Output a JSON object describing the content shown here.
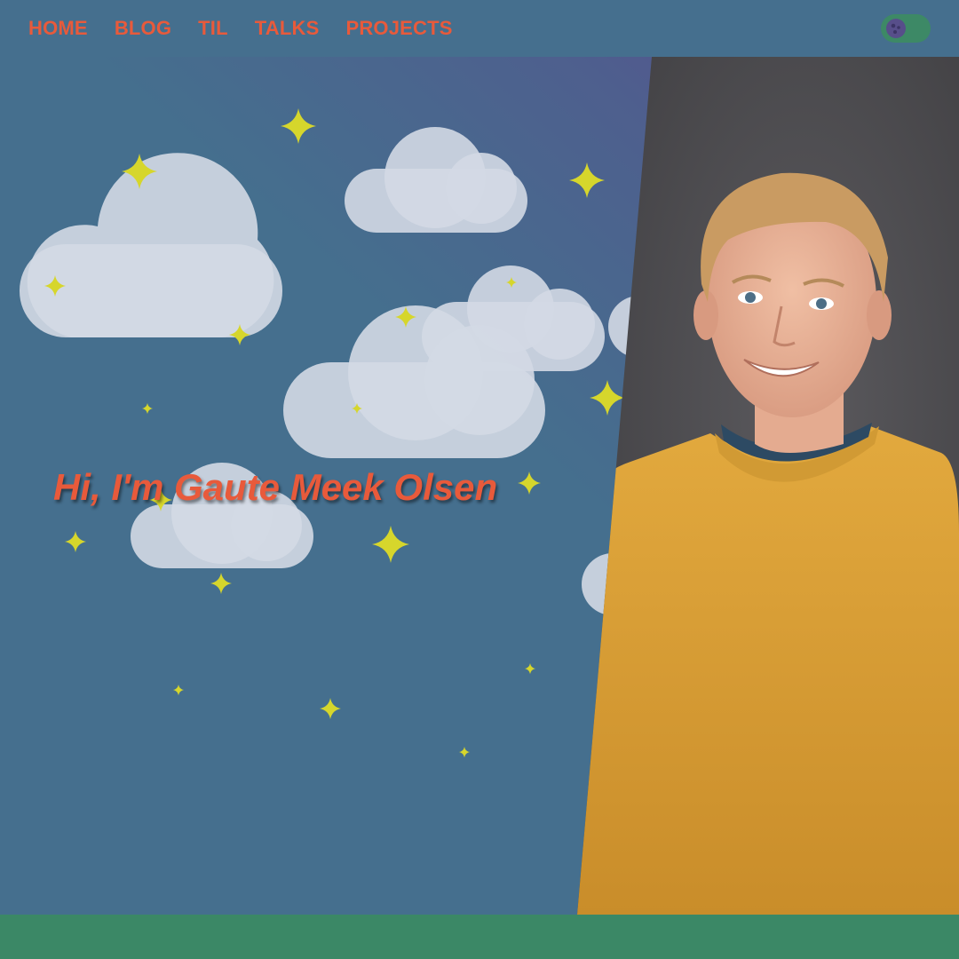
{
  "nav": {
    "items": [
      {
        "label": "HOME"
      },
      {
        "label": "BLOG"
      },
      {
        "label": "TIL"
      },
      {
        "label": "TALKS"
      },
      {
        "label": "PROJECTS"
      }
    ]
  },
  "theme_toggle": {
    "icon": "moon-icon",
    "state": "dark"
  },
  "hero": {
    "heading": "Hi, I'm Gaute Meek Olsen",
    "photo": "portrait-photo"
  },
  "colors": {
    "background": "#456f8e",
    "nav_text": "#e85a3b",
    "toggle_track": "#3d8966",
    "toggle_knob": "#574e8a",
    "star": "#d6d62c",
    "cloud": "#d3d9e4",
    "footer": "#3b8866"
  }
}
